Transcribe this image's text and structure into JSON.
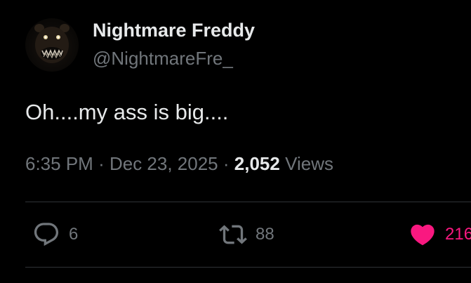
{
  "author": {
    "display_name": "Nightmare Freddy",
    "handle": "@NightmareFre_",
    "avatar_icon": "nightmare-freddy-avatar"
  },
  "tweet": {
    "text": "Oh....my ass is big....",
    "time": "6:35 PM",
    "separator": "·",
    "date": "Dec 23, 2025",
    "views_count": "2,052",
    "views_label": "Views"
  },
  "actions": {
    "reply": {
      "icon": "reply-icon",
      "count": "6"
    },
    "retweet": {
      "icon": "retweet-icon",
      "count": "88"
    },
    "like": {
      "icon": "heart-icon",
      "count": "216",
      "liked": true,
      "color": "#f91880"
    }
  },
  "colors": {
    "background": "#000000",
    "primary_text": "#e7e9ea",
    "secondary_text": "#71767b",
    "divider": "#2f3336",
    "like": "#f91880"
  }
}
